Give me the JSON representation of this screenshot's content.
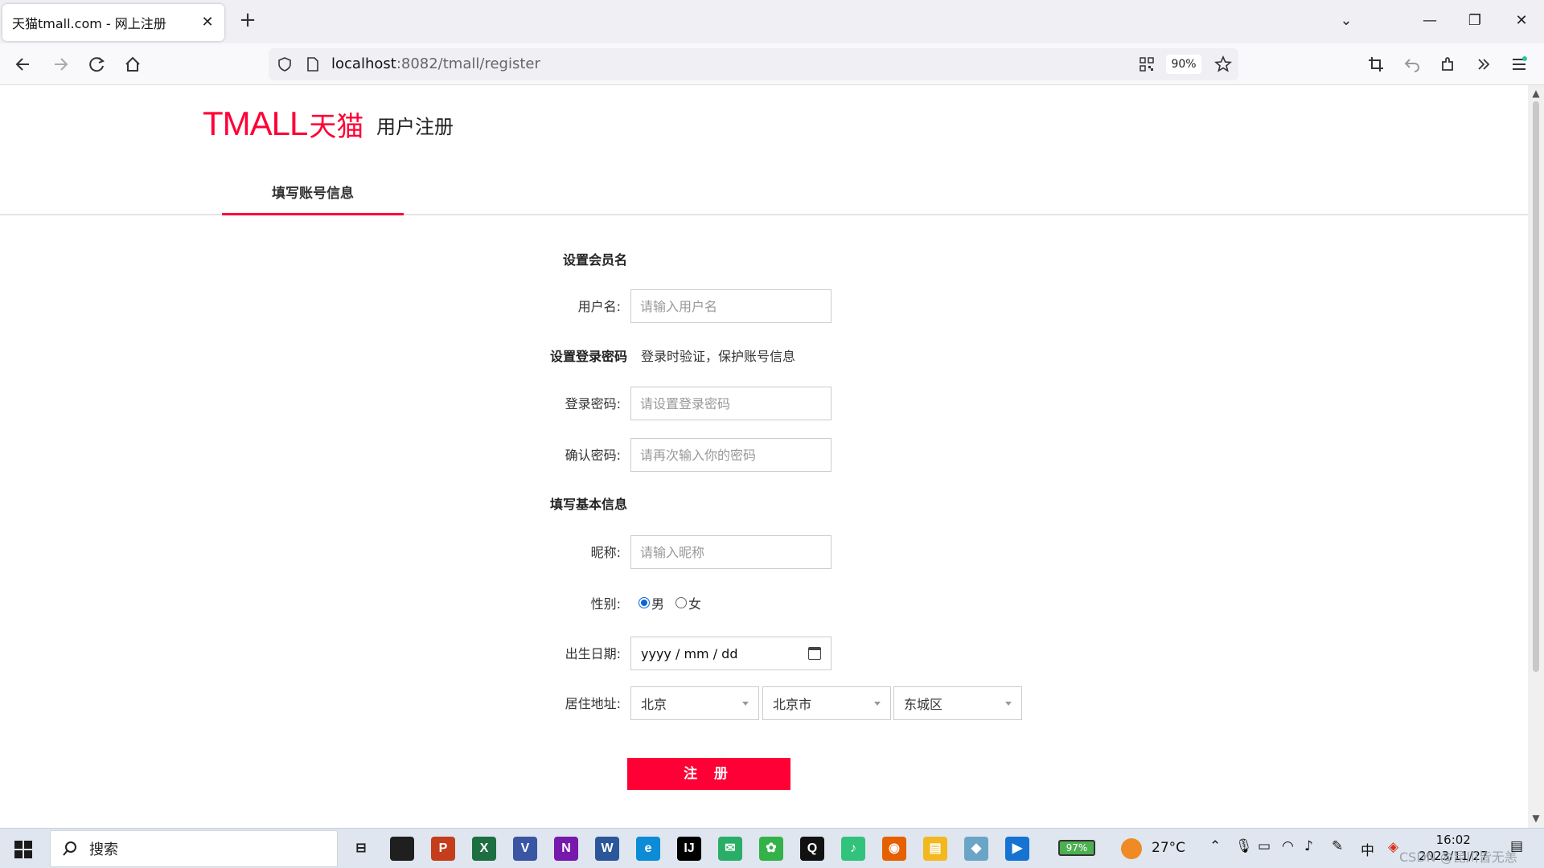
{
  "browser": {
    "tab_title": "天猫tmall.com - 网上注册",
    "tab_close": "✕",
    "new_tab": "+",
    "url_host": "localhost",
    "url_rest": ":8082/tmall/register",
    "zoom": "90%",
    "window_controls": [
      "⌄",
      "—",
      "❐",
      "✕"
    ]
  },
  "page": {
    "logo_text": "TMALL",
    "logo_cn": "天猫",
    "title": "用户注册",
    "step_tab": "填写账号信息"
  },
  "form": {
    "section_member": "设置会员名",
    "username_label": "用户名:",
    "username_placeholder": "请输入用户名",
    "section_password": "设置登录密码",
    "password_note": "登录时验证，保护账号信息",
    "password_label": "登录密码:",
    "password_placeholder": "请设置登录密码",
    "confirm_label": "确认密码:",
    "confirm_placeholder": "请再次输入你的密码",
    "section_basic": "填写基本信息",
    "nickname_label": "昵称:",
    "nickname_placeholder": "请输入昵称",
    "gender_label": "性别:",
    "gender_male": "男",
    "gender_female": "女",
    "gender_selected": "男",
    "birthday_label": "出生日期:",
    "birthday_value": "yyyy / mm / dd",
    "address_label": "居住地址:",
    "province": "北京",
    "city": "北京市",
    "district": "东城区",
    "submit": "注 册"
  },
  "taskbar": {
    "search_text": "搜索",
    "battery": "97%",
    "temperature": "27°C",
    "ime": "中",
    "time": "16:02",
    "date": "2023/11/27",
    "watermark": "CSDN @昆川皆无恙",
    "apps": [
      {
        "name": "task-view",
        "label": "⊟",
        "color": "#dfe6ef"
      },
      {
        "name": "sticky-notes",
        "label": "",
        "color": "#1f1f1f"
      },
      {
        "name": "powerpoint",
        "label": "P",
        "color": "#c43e1c"
      },
      {
        "name": "excel",
        "label": "X",
        "color": "#1d6f42"
      },
      {
        "name": "visio",
        "label": "V",
        "color": "#3955a3"
      },
      {
        "name": "onenote",
        "label": "N",
        "color": "#7719aa"
      },
      {
        "name": "word",
        "label": "W",
        "color": "#2b579a"
      },
      {
        "name": "edge",
        "label": "e",
        "color": "#0c8bd6"
      },
      {
        "name": "intellij",
        "label": "IJ",
        "color": "#000000"
      },
      {
        "name": "wechat",
        "label": "✉",
        "color": "#2aae67"
      },
      {
        "name": "app-green",
        "label": "✿",
        "color": "#33b24a"
      },
      {
        "name": "qq",
        "label": "Q",
        "color": "#111111"
      },
      {
        "name": "qq-music",
        "label": "♪",
        "color": "#31c27c"
      },
      {
        "name": "firefox",
        "label": "◉",
        "color": "#e66000"
      },
      {
        "name": "file-explorer",
        "label": "▤",
        "color": "#f3b81f"
      },
      {
        "name": "app-blue",
        "label": "◆",
        "color": "#6aa5c8"
      },
      {
        "name": "media-player",
        "label": "▶",
        "color": "#1673d1"
      }
    ]
  },
  "colors": {
    "brand": "#ff0036",
    "radio": "#0a66d8"
  }
}
